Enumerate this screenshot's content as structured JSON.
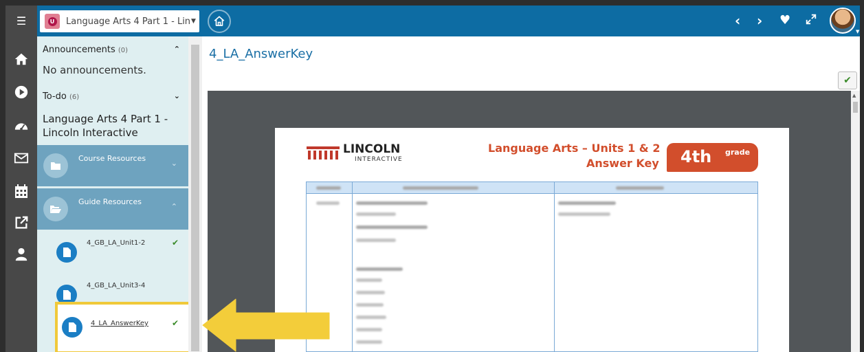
{
  "topbar": {
    "course_select": "Language Arts 4 Part 1 - Linc...",
    "course_logo_letter": "U"
  },
  "icons": {
    "menu": "hamburger-icon",
    "home": "home-icon",
    "prev": "chevron-left-icon",
    "next": "chevron-right-icon",
    "favorite": "heart-icon",
    "expand": "expand-icon"
  },
  "rail": [
    "home-icon",
    "play-icon",
    "dashboard-icon",
    "mail-icon",
    "calendar-icon",
    "external-link-icon",
    "user-icon"
  ],
  "sidebar": {
    "announcements_label": "Announcements",
    "announcements_count": "(0)",
    "announcements_body": "No announcements.",
    "todo_label": "To-do",
    "todo_count": "(6)",
    "course_name": "Language Arts 4 Part 1 - Lincoln Interactive",
    "sections": [
      {
        "label": "Course Resources",
        "expanded": false
      },
      {
        "label": "Guide Resources",
        "expanded": true
      }
    ],
    "items": [
      {
        "label": "4_GB_LA_Unit1-2",
        "completed": true
      },
      {
        "label": "4_GB_LA_Unit3-4",
        "completed": false
      },
      {
        "label": "4_LA_AnswerKey",
        "completed": true
      }
    ]
  },
  "content": {
    "title": "4_LA_AnswerKey"
  },
  "document": {
    "logo_name": "LINCOLN",
    "logo_sub": "INTERACTIVE",
    "title_line1": "Language Arts – Units 1 & 2",
    "title_line2": "Answer Key",
    "grade_big": "4th",
    "grade_small": "grade"
  },
  "colors": {
    "topbar": "#0d6ca3",
    "rail": "#484848",
    "sidebar": "#dfeff1",
    "section": "#6ea3bf",
    "doc_accent": "#d24e2c",
    "highlight": "#f0c93a",
    "check": "#3a8b2a"
  }
}
